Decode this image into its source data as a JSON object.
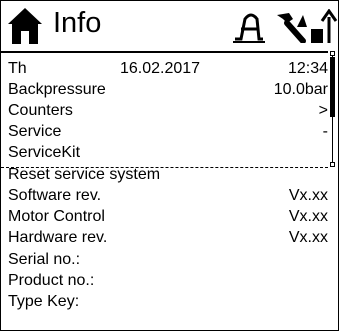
{
  "header": {
    "title": "Info",
    "home_icon": "home-icon",
    "status_icons": [
      "compressor-icon",
      "service-wrench-icon",
      "unload-arrow-icon"
    ]
  },
  "menu": {
    "date_row": {
      "weekday": "Th",
      "date": "16.02.2017",
      "time": "12:34"
    },
    "rows": [
      {
        "label": "Backpressure",
        "value": "10.0bar"
      },
      {
        "label": "Counters",
        "value": ">"
      },
      {
        "label": "Service",
        "value": "-"
      },
      {
        "label": "ServiceKit",
        "value": ""
      }
    ]
  },
  "info": {
    "reset": "Reset service system",
    "software": {
      "label": "Software rev.",
      "value": "Vx.xx"
    },
    "motor": {
      "label": "Motor Control",
      "value": "Vx.xx"
    },
    "hardware": {
      "label": "Hardware rev.",
      "value": "Vx.xx"
    },
    "serial": {
      "label": "Serial no.:",
      "value": ""
    },
    "product": {
      "label": "Product no.:",
      "value": ""
    },
    "typekey": {
      "label": "Type Key:",
      "value": ""
    }
  }
}
